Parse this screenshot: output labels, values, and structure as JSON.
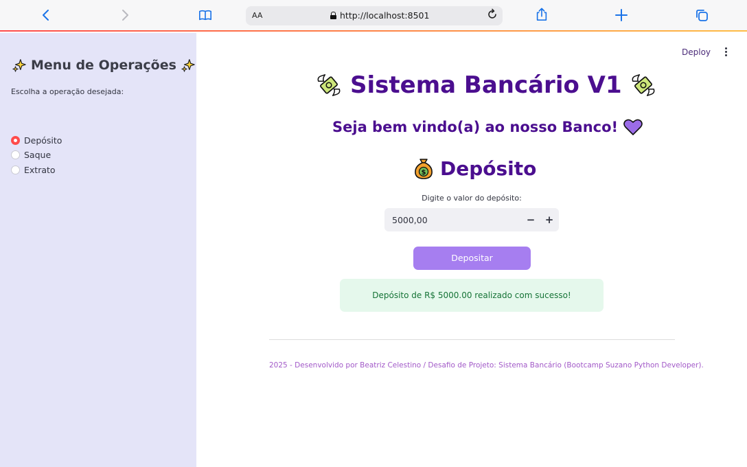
{
  "browser": {
    "text_size_label": "AA",
    "url": "http://localhost:8501"
  },
  "sidebar": {
    "title": "Menu de Operações",
    "radio_label": "Escolha a operação desejada:",
    "options": [
      {
        "label": "Depósito",
        "selected": true
      },
      {
        "label": "Saque",
        "selected": false
      },
      {
        "label": "Extrato",
        "selected": false
      }
    ]
  },
  "header": {
    "deploy_label": "Deploy"
  },
  "main": {
    "title": "Sistema Bancário V1",
    "welcome": "Seja bem vindo(a) ao nosso Banco!",
    "section_title": "Depósito",
    "input_label": "Digite o valor do depósito:",
    "input_value": "5000,00",
    "minus_label": "−",
    "plus_label": "+",
    "button_label": "Depositar",
    "success_message": "Depósito de R$ 5000.00 realizado com sucesso!",
    "footer": "2025 - Desenvolvido por Beatriz Celestino / Desafio de Projeto: Sistema Bancário (Bootcamp Suzano Python Developer)."
  },
  "colors": {
    "accent_purple": "#4b0e8f",
    "button_purple": "#a67ef0",
    "sidebar_bg": "#e4e4f8",
    "success_bg": "#e5f8ec",
    "success_text": "#157336",
    "radio_selected": "#ff4b4b"
  },
  "icons": [
    "back-icon",
    "forward-icon",
    "bookmarks-icon",
    "lock-icon",
    "reload-icon",
    "share-icon",
    "new-tab-icon",
    "tabs-icon",
    "sparkle-icon",
    "money-bill-wings-icon",
    "purple-heart-icon",
    "money-bag-icon",
    "kebab-menu-icon"
  ]
}
